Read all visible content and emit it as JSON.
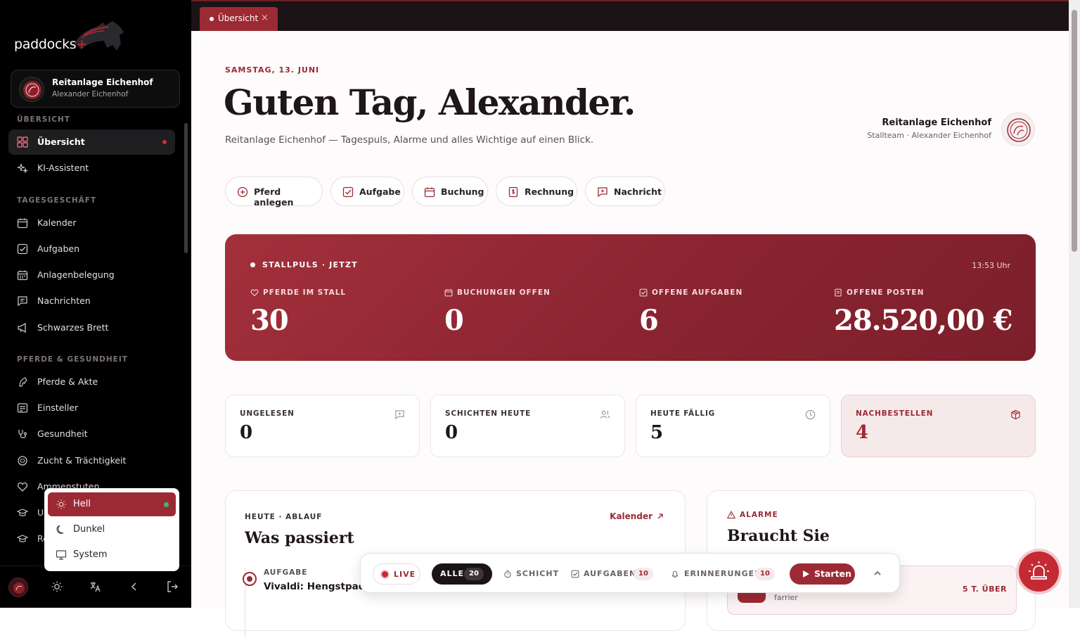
{
  "brand": {
    "name": "paddocks",
    "plus": "+"
  },
  "org": {
    "name": "Reitanlage Eichenhof",
    "user": "Alexander Eichenhof"
  },
  "sidebar": {
    "sections": [
      "ÜBERSICHT",
      "TAGESGESCHÄFT",
      "PFERDE & GESUNDHEIT"
    ],
    "items": [
      {
        "label": "Übersicht",
        "icon": "grid-icon",
        "active": true
      },
      {
        "label": "KI-Assistent",
        "icon": "sparkle-icon"
      },
      {
        "label": "Kalender",
        "icon": "calendar-icon"
      },
      {
        "label": "Aufgaben",
        "icon": "checkbox-icon"
      },
      {
        "label": "Anlagenbelegung",
        "icon": "calendar-grid-icon"
      },
      {
        "label": "Nachrichten",
        "icon": "message-icon"
      },
      {
        "label": "Schwarzes Brett",
        "icon": "megaphone-icon"
      },
      {
        "label": "Pferde & Akte",
        "icon": "horse-icon"
      },
      {
        "label": "Einsteller",
        "icon": "id-card-icon"
      },
      {
        "label": "Gesundheit",
        "icon": "stethoscope-icon"
      },
      {
        "label": "Zucht & Trächtigkeit",
        "icon": "cycle-icon"
      },
      {
        "label": "Ammenstuten",
        "icon": "heart-icon"
      },
      {
        "label": "U",
        "icon": "graduation-icon"
      },
      {
        "label": "Re",
        "icon": "graduation-icon"
      }
    ]
  },
  "theme_menu": {
    "options": [
      "Hell",
      "Dunkel",
      "System"
    ],
    "selected": "Hell"
  },
  "tabs": [
    {
      "label": "Übersicht",
      "close": "×"
    }
  ],
  "header": {
    "date": "SAMSTAG, 13. JUNI",
    "greeting": "Guten Tag, Alexander.",
    "intro": "Reitanlage Eichenhof — Tagespuls, Alarme und alles Wichtige auf einen Blick.",
    "org_name": "Reitanlage Eichenhof",
    "org_sub": "Stallteam · Alexander Eichenhof"
  },
  "quick_actions": [
    "Pferd anlegen",
    "Aufgabe",
    "Buchung",
    "Rechnung",
    "Nachricht"
  ],
  "pulse": {
    "title": "STALLPULS · JETZT",
    "time": "13:53 Uhr",
    "stats": [
      {
        "label": "PFERDE IM STALL",
        "value": "30"
      },
      {
        "label": "BUCHUNGEN OFFEN",
        "value": "0"
      },
      {
        "label": "OFFENE AUFGABEN",
        "value": "6"
      },
      {
        "label": "OFFENE POSTEN",
        "value": "28.520,00 €"
      }
    ]
  },
  "cards": [
    {
      "label": "UNGELESEN",
      "value": "0"
    },
    {
      "label": "SCHICHTEN HEUTE",
      "value": "0"
    },
    {
      "label": "HEUTE FÄLLIG",
      "value": "5"
    },
    {
      "label": "NACHBESTELLEN",
      "value": "4"
    }
  ],
  "today": {
    "kicker": "HEUTE · ABLAUF",
    "title": "Was passiert",
    "link": "Kalender",
    "item_kind": "AUFGABE",
    "item_title": "Vivaldi: Hengstpaddoc"
  },
  "alarms": {
    "kicker": "ALARME",
    "title": "Braucht Sie",
    "item_sub": "farrier",
    "item_badge": "5 T. ÜBER"
  },
  "livebar": {
    "live": "LIVE",
    "all": "ALLE",
    "all_count": "20",
    "shift": "SCHICHT",
    "tasks": "AUFGABEN",
    "tasks_count": "10",
    "reminders": "ERINNERUNGEN",
    "reminders_count": "10",
    "start": "Starten"
  },
  "colors": {
    "accent": "#9c2a35",
    "sidebar_bg": "#000000",
    "online": "#2fbf6f"
  }
}
